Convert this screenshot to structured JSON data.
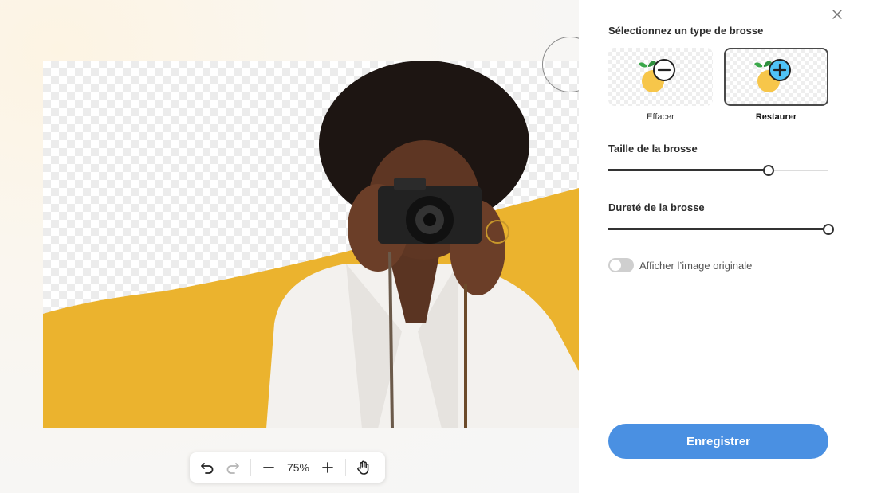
{
  "editor": {
    "zoom": "75%",
    "colors": {
      "background_shape": "#ebb32e",
      "transparency_check": "#ececec"
    }
  },
  "panel": {
    "brush_type_title": "Sélectionnez un type de brosse",
    "brushes": [
      {
        "label": "Effacer",
        "icon": "erase-brush-icon",
        "selected": false
      },
      {
        "label": "Restaurer",
        "icon": "restore-brush-icon",
        "selected": true
      }
    ],
    "brush_size_title": "Taille de la brosse",
    "brush_size_value": 0.73,
    "brush_hardness_title": "Dureté de la brosse",
    "brush_hardness_value": 1.0,
    "show_original_label": "Afficher l’image originale",
    "show_original_on": false,
    "save_label": "Enregistrer"
  },
  "colors": {
    "accent": "#4a90e2",
    "restore": "#4fc3f7"
  }
}
